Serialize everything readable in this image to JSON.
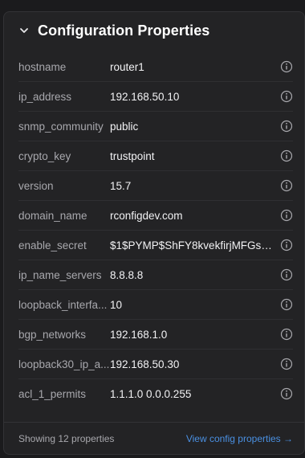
{
  "panel": {
    "title": "Configuration Properties"
  },
  "properties": [
    {
      "key": "hostname",
      "value": "router1"
    },
    {
      "key": "ip_address",
      "value": "192.168.50.10"
    },
    {
      "key": "snmp_community",
      "value": "public"
    },
    {
      "key": "crypto_key",
      "value": "trustpoint"
    },
    {
      "key": "version",
      "value": "15.7"
    },
    {
      "key": "domain_name",
      "value": "rconfigdev.com"
    },
    {
      "key": "enable_secret",
      "value": "$1$PYMP$ShFY8kvekfirjMFGsP..."
    },
    {
      "key": "ip_name_servers",
      "value": "8.8.8.8"
    },
    {
      "key": "loopback_interfa...",
      "value": "10"
    },
    {
      "key": "bgp_networks",
      "value": "192.168.1.0"
    },
    {
      "key": "loopback30_ip_a...",
      "value": "192.168.50.30"
    },
    {
      "key": "acl_1_permits",
      "value": "1.1.1.0 0.0.0.255"
    }
  ],
  "footer": {
    "count_text": "Showing 12 properties",
    "link_label": "View config properties →"
  },
  "icons": {
    "collapse": "chevron-down-icon",
    "info": "info-icon"
  },
  "colors": {
    "background": "#1b1b1d",
    "panel": "#232325",
    "link": "#4a90e2"
  }
}
